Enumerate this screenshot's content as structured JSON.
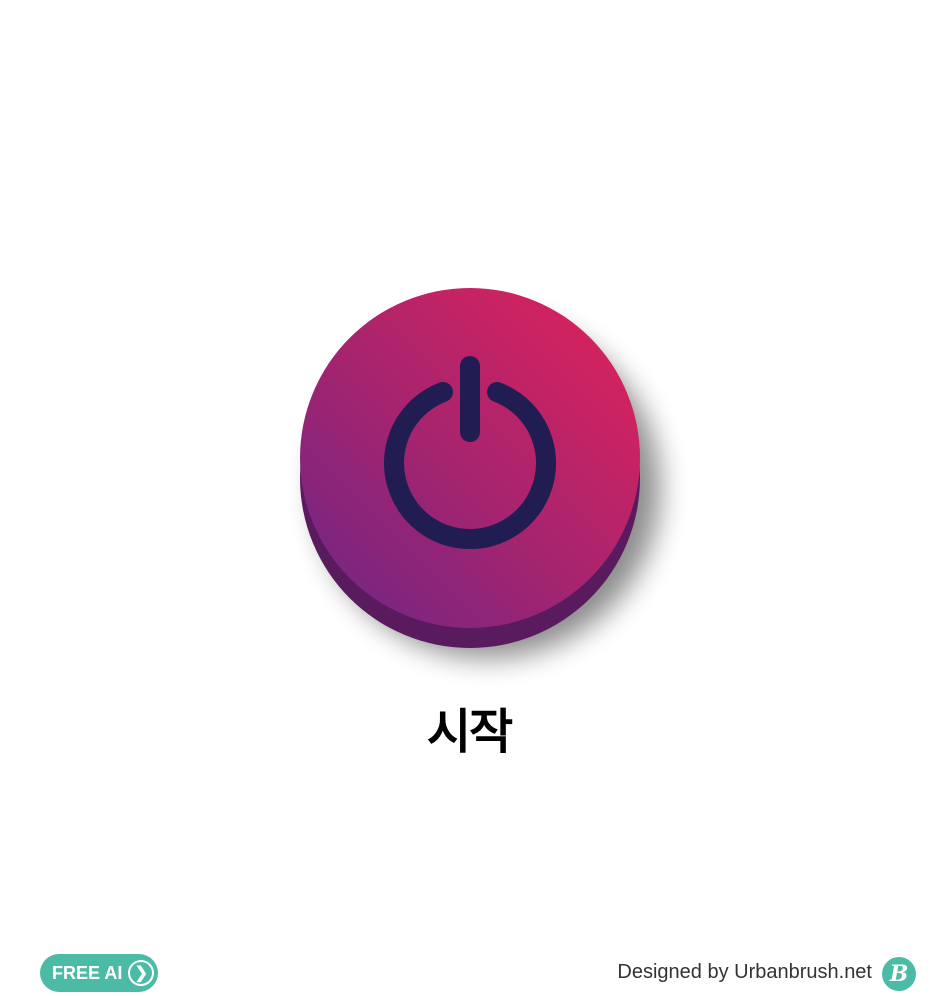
{
  "button": {
    "label": "시작",
    "icon": "power-icon"
  },
  "colors": {
    "top_start": "#dc2359",
    "top_end": "#772683",
    "side": "#5a1a5e",
    "icon": "#211d52",
    "accent": "#4cbba6"
  },
  "footer": {
    "badge_label": "FREE AI",
    "badge_icon": "chevron-right-icon",
    "credit": "Designed by Urbanbrush.net",
    "logo_text": "B"
  }
}
